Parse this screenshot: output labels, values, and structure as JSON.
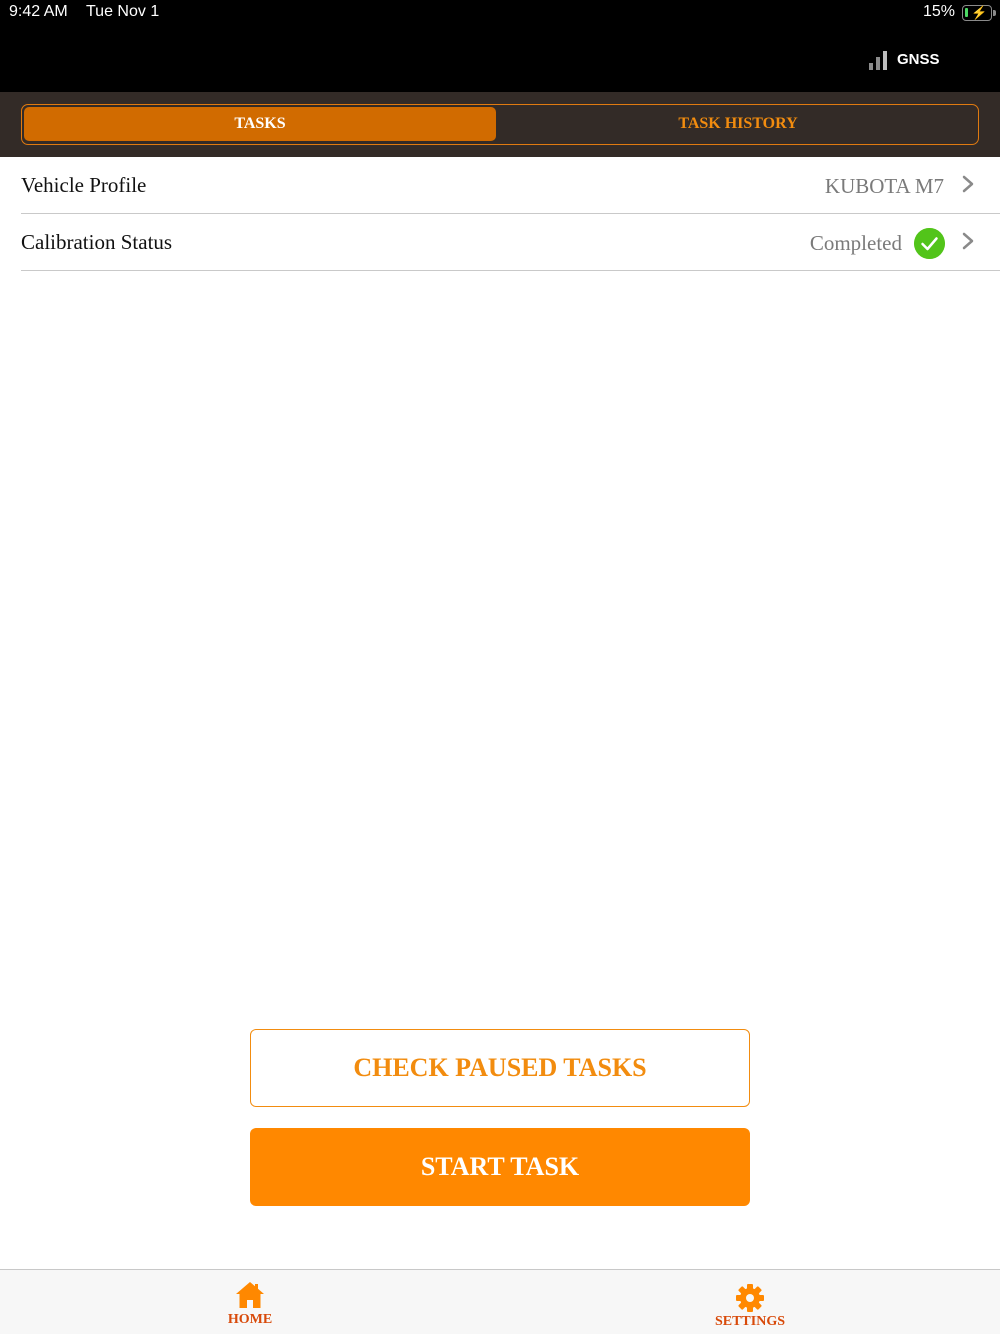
{
  "status_bar": {
    "time": "9:42 AM",
    "date": "Tue Nov 1",
    "battery_percent": "15%",
    "battery_level": 0.15,
    "gnss_label": "GNSS"
  },
  "segment": {
    "tabs": [
      {
        "label": "TASKS",
        "active": true
      },
      {
        "label": "TASK HISTORY",
        "active": false
      }
    ]
  },
  "list": {
    "vehicle_profile": {
      "label": "Vehicle Profile",
      "value": "KUBOTA M7"
    },
    "calibration_status": {
      "label": "Calibration Status",
      "value": "Completed",
      "status_icon": "check-circle-icon"
    }
  },
  "actions": {
    "check_paused_label": "CHECK PAUSED TASKS",
    "start_task_label": "START TASK"
  },
  "tab_bar": {
    "items": [
      {
        "label": "HOME",
        "icon": "home-icon"
      },
      {
        "label": "SETTINGS",
        "icon": "gear-icon"
      }
    ]
  },
  "colors": {
    "accent": "#ff8800",
    "accent_dark": "#d16b00",
    "header_bg": "#332b27",
    "tab_label": "#d84a0a",
    "success": "#52c41a"
  }
}
